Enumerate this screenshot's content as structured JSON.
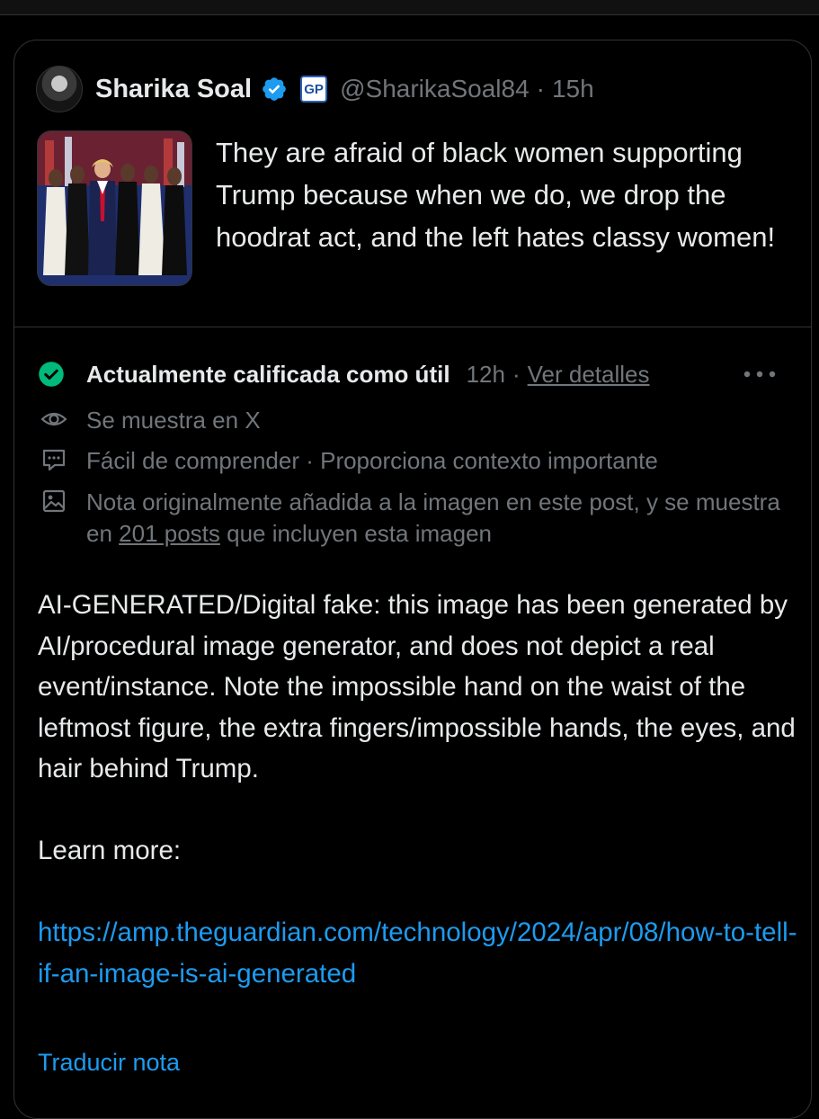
{
  "post": {
    "author_name": "Sharika Soal",
    "handle": "@SharikaSoal84",
    "separator": "·",
    "time": "15h",
    "affiliate_badge": "GP",
    "text": "They are afraid of black women supporting Trump because when we do, we drop the hoodrat act, and the left hates classy women!"
  },
  "note": {
    "status": "Actualmente calificada como útil",
    "time": "12h",
    "separator": "·",
    "details_link": "Ver detalles",
    "shown_on": "Se muestra en X",
    "ratings": "Fácil de comprender · Proporciona contexto importante",
    "image_note_prefix": "Nota originalmente añadida a la imagen en este post, y se muestra en ",
    "image_note_link": "201 posts",
    "image_note_suffix": " que incluyen esta imagen",
    "body": "AI-GENERATED/Digital fake: this image has been generated by AI/procedural image generator, and does not depict a real event/instance. Note the impossible hand on the waist of the leftmost figure, the extra fingers/impossible hands, the eyes, and hair behind Trump.",
    "learn_more": "Learn more:",
    "url": "https://amp.theguardian.com/technology/2024/apr/08/how-to-tell-if-an-image-is-ai-generated",
    "translate": "Traducir nota"
  },
  "icons": {
    "verified": "verified-badge-icon",
    "check": "check-circle-icon",
    "more": "more-icon",
    "eye": "eye-icon",
    "message": "message-icon",
    "image": "image-icon"
  },
  "colors": {
    "background": "#000000",
    "text": "#e7e9ea",
    "muted": "#71767b",
    "link": "#1d9bf0",
    "verified": "#1d9bf0",
    "helpful": "#00ba7c",
    "border": "#2f3336"
  }
}
